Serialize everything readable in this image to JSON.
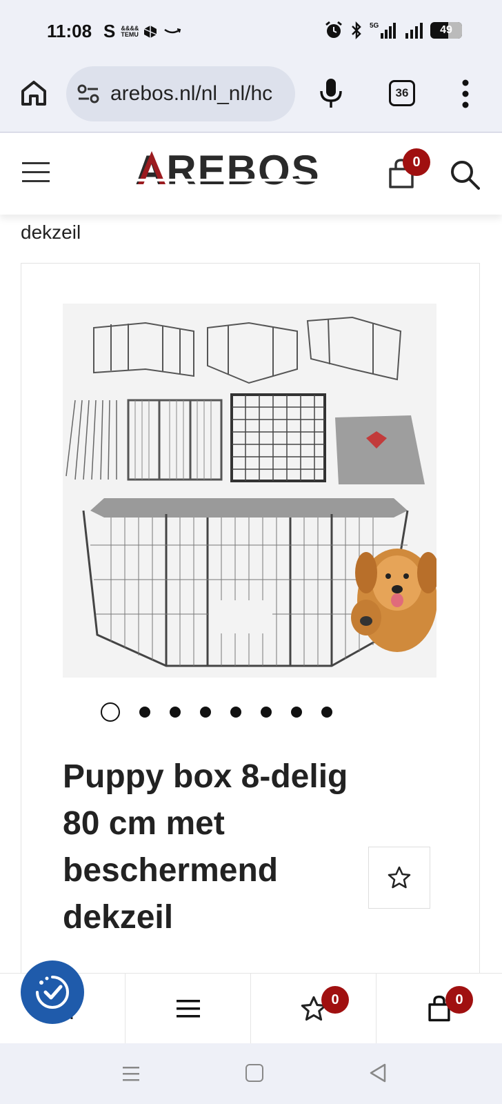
{
  "status_bar": {
    "time": "11:08",
    "left_icons": [
      "s-icon",
      "temu-icon",
      "cube-icon",
      "amazon-icon"
    ],
    "s_glyph": "S",
    "temu_lines": [
      "&&&&",
      "TEMU"
    ],
    "network": "5G",
    "battery": "49"
  },
  "browser": {
    "url": "arebos.nl/nl_nl/hc",
    "tabs_count": "36"
  },
  "site": {
    "brand": "AREBOS",
    "brand_color": "#9b1b1f",
    "cart_count": "0"
  },
  "breadcrumb_tail": "dekzeil",
  "product": {
    "image_alt": "Puppy box met dekzeil en hond",
    "title": "Puppy box 8-delig 80 cm met beschermend dekzeil",
    "gallery_count": 8,
    "gallery_active_index": 0
  },
  "bottom_nav": {
    "wishlist_count": "0",
    "cart_count": "0"
  },
  "colors": {
    "accent": "#a01010",
    "accessibility": "#1f5bab"
  }
}
